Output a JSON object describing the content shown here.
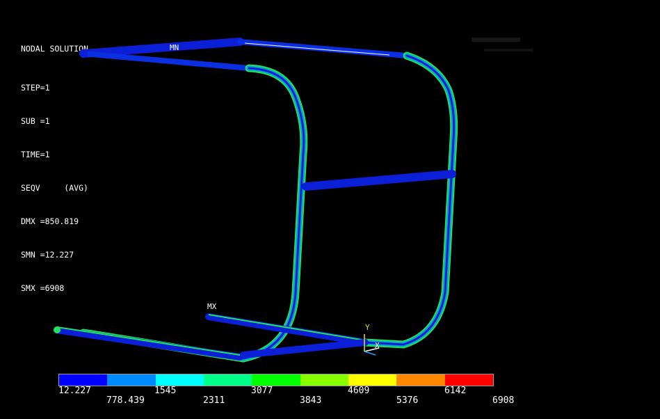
{
  "info": {
    "title": "NODAL SOLUTION",
    "lines": [
      "STEP=1",
      "SUB =1",
      "TIME=1",
      "SEQV     (AVG)",
      "DMX =850.819",
      "SMN =12.227",
      "SMX =6908"
    ]
  },
  "labels": {
    "mn": "MN",
    "mx": "MX"
  },
  "triad": {
    "y": "Y",
    "x": "X"
  },
  "legend": {
    "colors": [
      "#0000ff",
      "#0088ff",
      "#00ffff",
      "#00ff88",
      "#00ff00",
      "#88ff00",
      "#ffff00",
      "#ff8800",
      "#ff0000"
    ],
    "ticks_top": [
      "12.227",
      "1545",
      "3077",
      "4609",
      "6142"
    ],
    "ticks_bottom": [
      "778.439",
      "2311",
      "3843",
      "5376",
      "6908"
    ]
  },
  "colors": {
    "low": "#0a1fd6",
    "mid": "#0aa5c8",
    "high": "#22e05a"
  }
}
